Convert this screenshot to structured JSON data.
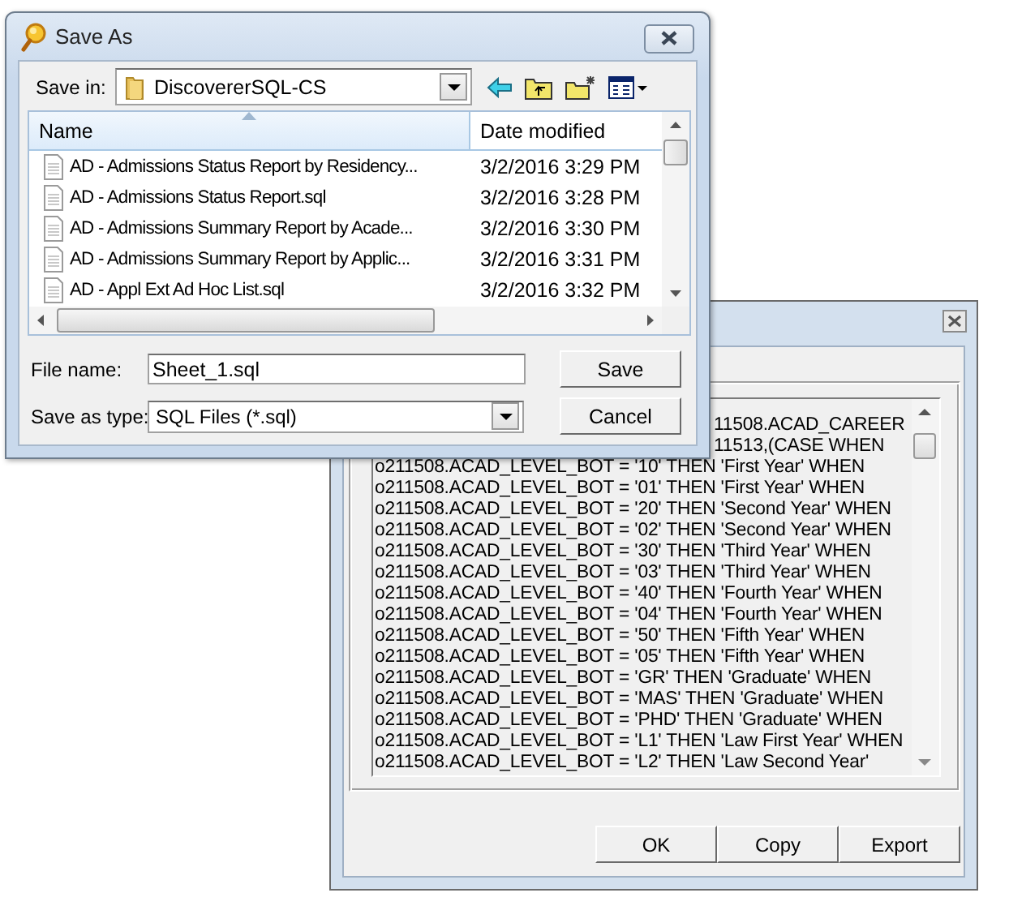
{
  "save_dialog": {
    "title": "Save As",
    "save_in_label": "Save in:",
    "save_in": "DiscovererSQL-CS",
    "columns": [
      {
        "label": "Name",
        "sorted": true
      },
      {
        "label": "Date modified",
        "sorted": false
      }
    ],
    "files": [
      {
        "name": "AD - Admissions Status Report by Residency...",
        "date": "3/2/2016 3:29 PM"
      },
      {
        "name": "AD - Admissions Status Report.sql",
        "date": "3/2/2016 3:28 PM"
      },
      {
        "name": "AD - Admissions Summary Report by Acade...",
        "date": "3/2/2016 3:30 PM"
      },
      {
        "name": "AD - Admissions Summary Report by Applic...",
        "date": "3/2/2016 3:31 PM"
      },
      {
        "name": "AD - Appl Ext Ad Hoc List.sql",
        "date": "3/2/2016 3:32 PM"
      }
    ],
    "file_name_label": "File name:",
    "file_name": "Sheet_1.sql",
    "type_label": "Save as type:",
    "type": "SQL Files (*.sql)",
    "buttons": [
      "Save",
      "Cancel"
    ]
  },
  "sql_window": {
    "lines": [
      {
        "kind": "tail",
        "text": "11508.ACAD_CAREER"
      },
      {
        "kind": "tail",
        "text": "11513,(CASE WHEN"
      },
      {
        "kind": "full",
        "text": "o211508.ACAD_LEVEL_BOT = '10' THEN 'First Year' WHEN"
      },
      {
        "kind": "full",
        "text": "o211508.ACAD_LEVEL_BOT = '01' THEN 'First Year' WHEN"
      },
      {
        "kind": "full",
        "text": "o211508.ACAD_LEVEL_BOT = '20' THEN 'Second Year' WHEN"
      },
      {
        "kind": "full",
        "text": "o211508.ACAD_LEVEL_BOT = '02' THEN 'Second Year' WHEN"
      },
      {
        "kind": "full",
        "text": "o211508.ACAD_LEVEL_BOT = '30' THEN 'Third Year' WHEN"
      },
      {
        "kind": "full",
        "text": "o211508.ACAD_LEVEL_BOT = '03' THEN 'Third Year' WHEN"
      },
      {
        "kind": "full",
        "text": "o211508.ACAD_LEVEL_BOT = '40' THEN 'Fourth Year' WHEN"
      },
      {
        "kind": "full",
        "text": "o211508.ACAD_LEVEL_BOT = '04' THEN 'Fourth Year' WHEN"
      },
      {
        "kind": "full",
        "text": "o211508.ACAD_LEVEL_BOT = '50' THEN 'Fifth Year' WHEN"
      },
      {
        "kind": "full",
        "text": "o211508.ACAD_LEVEL_BOT = '05' THEN 'Fifth Year' WHEN"
      },
      {
        "kind": "full",
        "text": "o211508.ACAD_LEVEL_BOT = 'GR' THEN 'Graduate' WHEN"
      },
      {
        "kind": "full",
        "text": "o211508.ACAD_LEVEL_BOT = 'MAS' THEN 'Graduate' WHEN"
      },
      {
        "kind": "full",
        "text": "o211508.ACAD_LEVEL_BOT = 'PHD' THEN 'Graduate' WHEN"
      },
      {
        "kind": "full",
        "text": "o211508.ACAD_LEVEL_BOT = 'L1' THEN 'Law First Year' WHEN"
      },
      {
        "kind": "full",
        "text": "o211508.ACAD_LEVEL_BOT = 'L2' THEN 'Law Second Year'"
      }
    ],
    "buttons": [
      "OK",
      "Copy",
      "Export"
    ]
  }
}
